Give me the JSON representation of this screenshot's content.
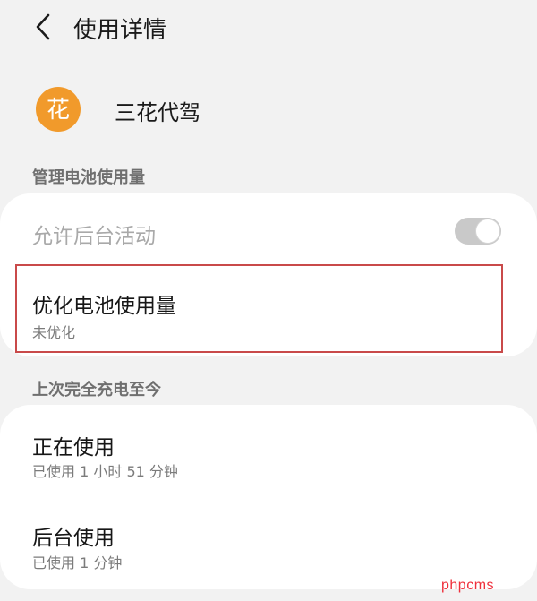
{
  "header": {
    "title": "使用详情"
  },
  "app": {
    "name": "三花代驾",
    "icon_glyph": "花",
    "icon_color": "#f19a2b"
  },
  "section_battery": {
    "label": "管理电池使用量"
  },
  "battery": {
    "allow_background": {
      "label": "允许后台活动",
      "toggle_on": true,
      "enabled": false
    },
    "optimize": {
      "title": "优化电池使用量",
      "subtitle": "未优化"
    }
  },
  "section_charge": {
    "label": "上次完全充电至今"
  },
  "usage": {
    "foreground": {
      "title": "正在使用",
      "subtitle": "已使用 1 小时 51 分钟"
    },
    "background": {
      "title": "后台使用",
      "subtitle": "已使用 1 分钟"
    }
  },
  "watermark": {
    "text": "phpcms"
  }
}
